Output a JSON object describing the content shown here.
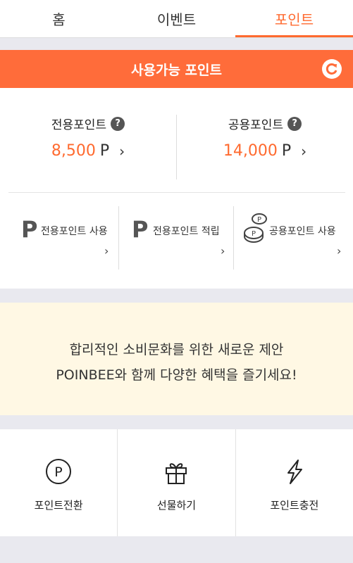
{
  "tabs": [
    {
      "label": "홈",
      "active": false
    },
    {
      "label": "이벤트",
      "active": false
    },
    {
      "label": "포인트",
      "active": true
    }
  ],
  "banner": {
    "title": "사용가능 포인트",
    "refresh_icon": "refresh-icon"
  },
  "points": {
    "exclusive": {
      "label": "전용포인트",
      "value": "8,500",
      "unit": "P",
      "help_icon": "question-icon"
    },
    "shared": {
      "label": "공용포인트",
      "value": "14,000",
      "unit": "P",
      "help_icon": "question-icon"
    }
  },
  "actions": [
    {
      "label": "전용포인트 사용",
      "icon": "p-letter-icon"
    },
    {
      "label": "전용포인트 적립",
      "icon": "p-letter-icon"
    },
    {
      "label": "공용포인트 사용",
      "icon": "coins-icon"
    }
  ],
  "promo": {
    "line1": "합리적인 소비문화를 위한 새로운 제안",
    "line2": "POINBEE와 함께 다양한 혜택을 즐기세요!"
  },
  "bottom_menu": [
    {
      "label": "포인트전환",
      "icon": "point-circle-icon"
    },
    {
      "label": "선물하기",
      "icon": "gift-icon"
    },
    {
      "label": "포인트충전",
      "icon": "lightning-icon"
    }
  ],
  "colors": {
    "accent": "#ff6a2f",
    "banner": "#ff6c3a",
    "promo_bg": "#fff8e4"
  }
}
